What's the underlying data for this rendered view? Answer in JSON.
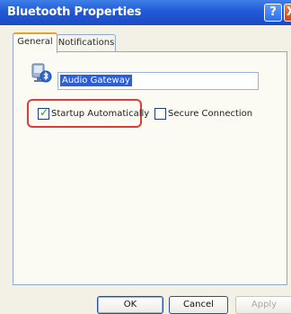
{
  "window": {
    "title": "Bluetooth Properties",
    "help_button": "?",
    "close_button": "X"
  },
  "tabs": [
    {
      "label": "General",
      "selected": true
    },
    {
      "label": "Notifications",
      "selected": false
    }
  ],
  "general": {
    "device_icon": "bluetooth-device-icon",
    "device_name": "Audio Gateway",
    "options": {
      "startup_automatically": {
        "label": "Startup Automatically",
        "checked": true,
        "check_glyph": "✓"
      },
      "secure_connection": {
        "label": "Secure Connection",
        "checked": false
      }
    },
    "highlight_color": "#e23a3a"
  },
  "buttons": {
    "ok": "OK",
    "cancel": "Cancel",
    "apply": "Apply"
  }
}
